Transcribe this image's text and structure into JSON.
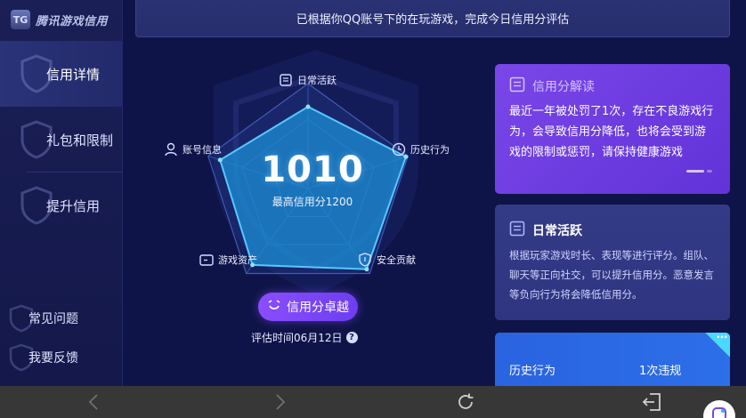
{
  "app": {
    "title": "腾讯游戏信用",
    "logo_text": "TG"
  },
  "sidebar": {
    "items": [
      {
        "label": "信用详情",
        "active": true
      },
      {
        "label": "礼包和限制",
        "active": false
      },
      {
        "label": "提升信用",
        "active": false
      }
    ],
    "bottom": [
      {
        "label": "常见问题"
      },
      {
        "label": "我要反馈"
      }
    ]
  },
  "banner": {
    "text": "已根据你QQ账号下的在玩游戏，完成今日信用分评估"
  },
  "radar": {
    "score": "1010",
    "max_text": "最高信用分1200",
    "level_label": "信用分卓越",
    "eval_time": "评估时间06月12日",
    "help_glyph": "?",
    "axes": [
      {
        "label": "日常活跃",
        "icon": "document-icon",
        "value": 0.78
      },
      {
        "label": "历史行为",
        "icon": "clock-icon",
        "value": 0.98
      },
      {
        "label": "安全贡献",
        "icon": "shield-icon",
        "value": 0.95
      },
      {
        "label": "游戏资产",
        "icon": "wallet-icon",
        "value": 0.9
      },
      {
        "label": "账号信息",
        "icon": "user-icon",
        "value": 0.88
      }
    ]
  },
  "cards": {
    "interpret": {
      "title": "信用分解读",
      "body": "最近一年被处罚了1次，存在不良游戏行为，会导致信用分降低，也将会受到游戏的限制或惩罚，请保持健康游戏"
    },
    "daily": {
      "title": "日常活跃",
      "body": "根据玩家游戏时长、表现等进行评分。组队、聊天等正向社交，可以提升信用分。恶意发言等负向行为将会降低信用分。"
    },
    "history": {
      "label": "历史行为",
      "value": "1次违规",
      "tag": "•••"
    }
  },
  "colors": {
    "bg": "#0f1448",
    "accent_purple": "#7a46e8",
    "accent_blue": "#2a63e0",
    "radar_fill": "#1c8fd6"
  },
  "navbar": {
    "buttons": [
      "back-icon",
      "forward-icon",
      "refresh-icon",
      "exit-icon"
    ]
  }
}
